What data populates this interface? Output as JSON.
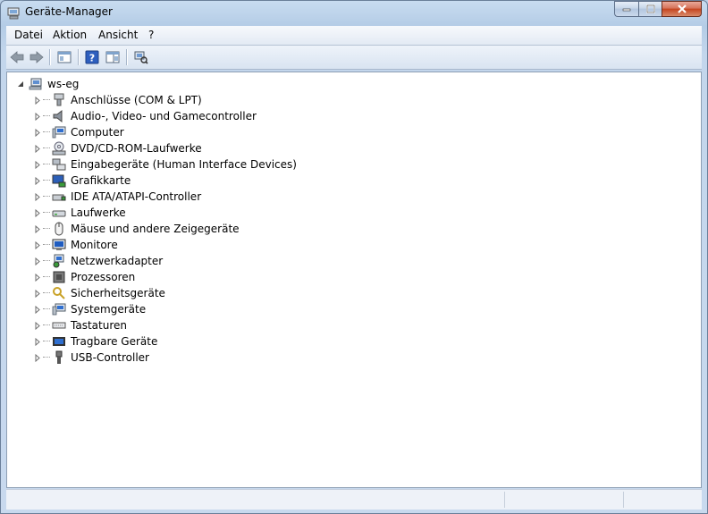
{
  "window": {
    "title": "Geräte-Manager"
  },
  "menu": {
    "items": [
      {
        "label": "Datei"
      },
      {
        "label": "Aktion"
      },
      {
        "label": "Ansicht"
      },
      {
        "label": "?"
      }
    ]
  },
  "toolbar": {
    "buttons": [
      {
        "icon": "back-arrow-icon"
      },
      {
        "icon": "forward-arrow-icon"
      },
      {
        "icon": "show-hide-console-tree-icon"
      },
      {
        "icon": "help-icon"
      },
      {
        "icon": "properties-view-icon"
      },
      {
        "icon": "scan-hardware-icon"
      }
    ]
  },
  "tree": {
    "root": {
      "label": "ws-eg",
      "icon": "computer-icon"
    },
    "nodes": [
      {
        "label": "Anschlüsse (COM & LPT)",
        "icon": "port-icon"
      },
      {
        "label": "Audio-, Video- und Gamecontroller",
        "icon": "speaker-icon"
      },
      {
        "label": "Computer",
        "icon": "computer-icon"
      },
      {
        "label": "DVD/CD-ROM-Laufwerke",
        "icon": "dvd-drive-icon"
      },
      {
        "label": "Eingabegeräte (Human Interface Devices)",
        "icon": "hid-icon"
      },
      {
        "label": "Grafikkarte",
        "icon": "display-adapter-icon"
      },
      {
        "label": "IDE ATA/ATAPI-Controller",
        "icon": "ide-controller-icon"
      },
      {
        "label": "Laufwerke",
        "icon": "disk-drive-icon"
      },
      {
        "label": "Mäuse und andere Zeigegeräte",
        "icon": "mouse-icon"
      },
      {
        "label": "Monitore",
        "icon": "monitor-icon"
      },
      {
        "label": "Netzwerkadapter",
        "icon": "network-adapter-icon"
      },
      {
        "label": "Prozessoren",
        "icon": "processor-icon"
      },
      {
        "label": "Sicherheitsgeräte",
        "icon": "security-device-icon"
      },
      {
        "label": "Systemgeräte",
        "icon": "system-devices-icon"
      },
      {
        "label": "Tastaturen",
        "icon": "keyboard-icon"
      },
      {
        "label": "Tragbare Geräte",
        "icon": "portable-device-icon"
      },
      {
        "label": "USB-Controller",
        "icon": "usb-icon"
      }
    ]
  },
  "colors": {
    "frame": "#bcd1e8",
    "close_button": "#c5441f",
    "panel_background": "#ffffff"
  }
}
